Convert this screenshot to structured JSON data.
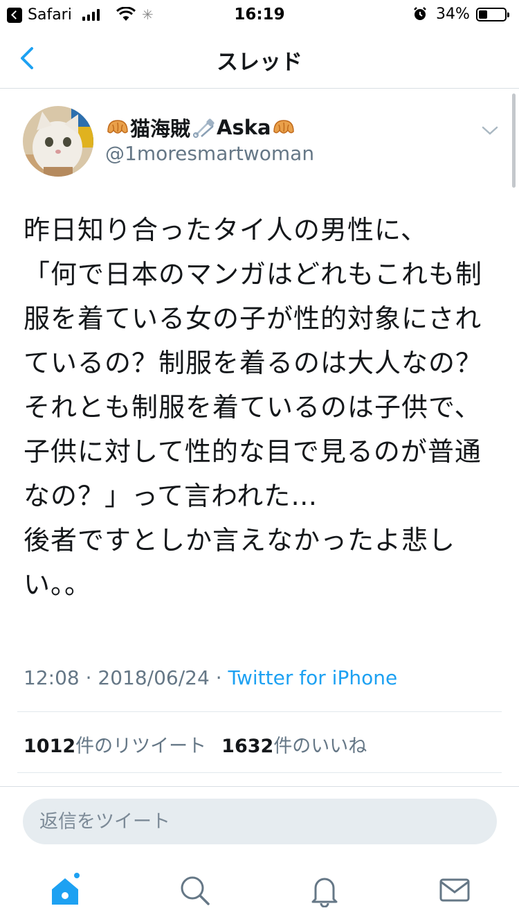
{
  "status_bar": {
    "back_app_label": "Safari",
    "time": "16:19",
    "battery_percent": "34%"
  },
  "nav": {
    "title": "スレッド"
  },
  "tweet": {
    "display_name": "猫海賊",
    "display_name_suffix": "Aska",
    "handle": "@1moresmartwoman",
    "text": "昨日知り合ったタイ人の男性に、\n「何で日本のマンガはどれもこれも制服を着ている女の子が性的対象にされているの？制服を着るのは大人なの？それとも制服を着ているのは子供で、子供に対して性的な目で見るのが普通なの？」って言われた…\n後者ですとしか言えなかったよ悲しい。。",
    "time": "12:08",
    "date": "2018/06/24",
    "source": "Twitter for iPhone",
    "retweet_count": "1012",
    "retweet_label": "件のリツイート",
    "like_count": "1632",
    "like_label": "件のいいね"
  },
  "reply": {
    "placeholder": "返信をツイート"
  },
  "tabbar": {
    "items": [
      "home-icon",
      "search-icon",
      "notifications-icon",
      "messages-icon"
    ]
  },
  "colors": {
    "accent": "#1da1f2",
    "secondary_text": "#657786",
    "divider": "#e1e8ed",
    "reply_bg": "#e6ecf0"
  }
}
